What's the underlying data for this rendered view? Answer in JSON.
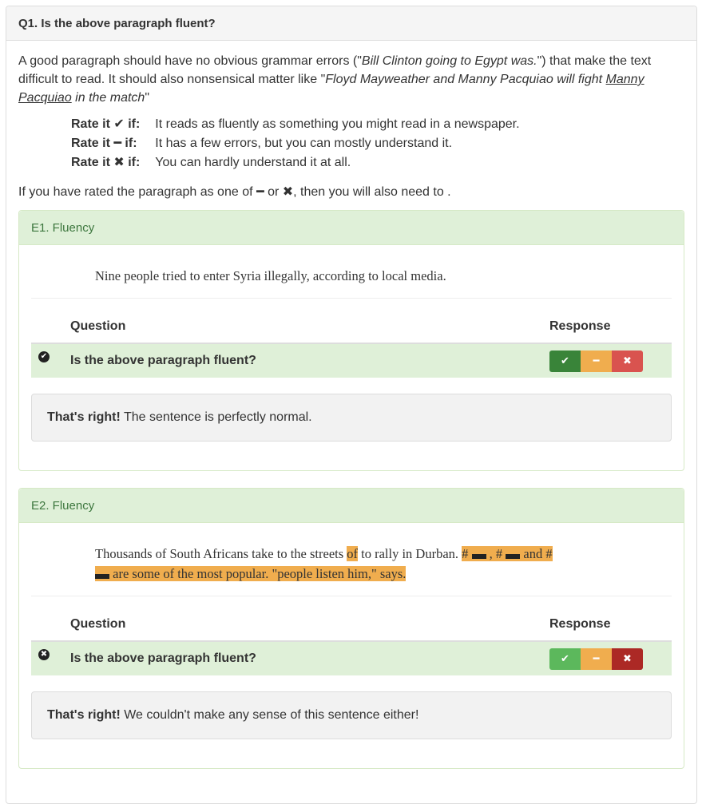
{
  "question": {
    "title": "Q1. Is the above paragraph fluent?",
    "intro_part1": "A good paragraph should have no obvious grammar errors (\"",
    "intro_em1": "Bill Clinton going to Egypt was.",
    "intro_part2": "\") that make the text difficult to read. It should also nonsensical matter like \"",
    "intro_em2a": "Floyd Mayweather and Manny Pacquiao will fight ",
    "intro_em2u": "Manny Pacquiao",
    "intro_em2b": " in the match",
    "intro_part3": "\"",
    "rates": [
      {
        "label_pre": "Rate it ",
        "symbol": "✔",
        "label_post": " if:",
        "desc": "It reads as fluently as something you might read in a newspaper."
      },
      {
        "label_pre": "Rate it ",
        "symbol": "━",
        "label_post": " if:",
        "desc": "It has a few errors, but you can mostly understand it."
      },
      {
        "label_pre": "Rate it ",
        "symbol": "✖",
        "label_post": " if:",
        "desc": "You can hardly understand it at all."
      }
    ],
    "followup_pre": "If you have rated the paragraph as one of ",
    "followup_sym1": "━",
    "followup_mid": " or ",
    "followup_sym2": "✖",
    "followup_post": ", then you will also need to ."
  },
  "examples": [
    {
      "title": "E1. Fluency",
      "sentence": "Nine people tried to enter Syria illegally, according to local media.",
      "col_question": "Question",
      "col_response": "Response",
      "row_question": "Is the above paragraph fluent?",
      "status_icon": "check-circle-icon",
      "status_glyph": "✔",
      "selected": "yes",
      "btn_yes": "✔",
      "btn_mid": "━",
      "btn_no": "✖",
      "feedback_bold": "That's right!",
      "feedback_text": " The sentence is perfectly normal."
    },
    {
      "title": "E2. Fluency",
      "sentence_a": "Thousands of South Africans take to the streets ",
      "sentence_hl1": "of",
      "sentence_b": " to rally in Durban. ",
      "sentence_hl2a": "# ",
      "sentence_hl2b": " , # ",
      "sentence_hl2c": " and #",
      "sentence_hl3": " are some of the most popular. \"people listen him,\" says.",
      "col_question": "Question",
      "col_response": "Response",
      "row_question": "Is the above paragraph fluent?",
      "status_icon": "x-circle-icon",
      "status_glyph": "✖",
      "selected": "no",
      "btn_yes": "✔",
      "btn_mid": "━",
      "btn_no": "✖",
      "feedback_bold": "That's right!",
      "feedback_text": " We couldn't make any sense of this sentence either!"
    }
  ],
  "colors": {
    "success_bg": "#dff0d8",
    "success_text": "#3c763d",
    "highlight": "#f0ad4e",
    "btn_yes": "#5cb85c",
    "btn_mid": "#f0ad4e",
    "btn_no": "#d9534f"
  }
}
